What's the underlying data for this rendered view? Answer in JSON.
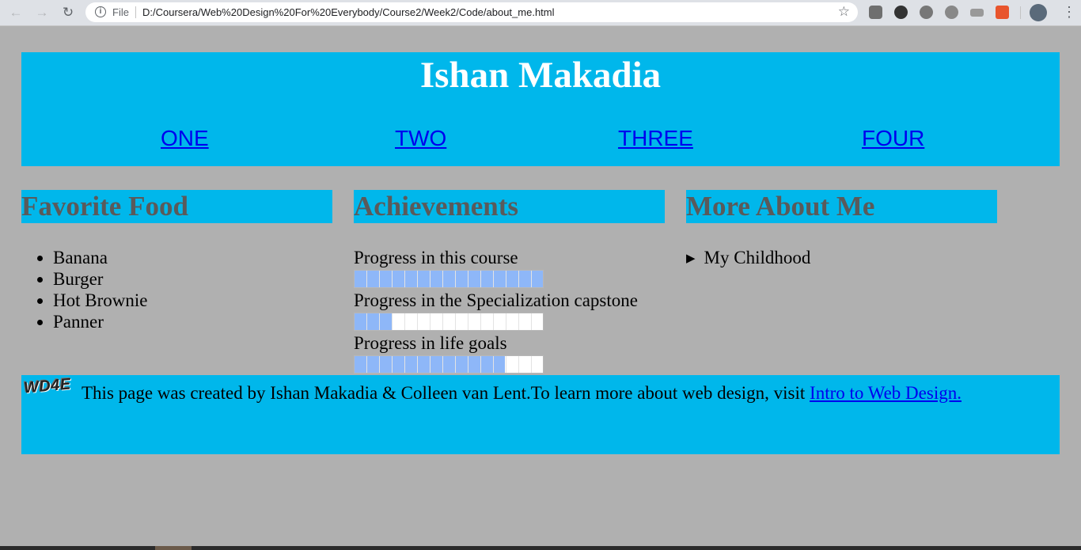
{
  "browser": {
    "back_icon": "←",
    "forward_icon": "→",
    "reload_icon": "↻",
    "scheme": "File",
    "url": "D:/Coursera/Web%20Design%20For%20Everybody/Course2/Week2/Code/about_me.html",
    "star_icon": "☆",
    "menu_icon": "⋮"
  },
  "header": {
    "title": "Ishan Makadia",
    "nav": [
      "ONE",
      "TWO",
      "THREE",
      "FOUR"
    ]
  },
  "columns": {
    "food": {
      "heading": "Favorite Food",
      "items": [
        "Banana",
        "Burger",
        "Hot Brownie",
        "Panner"
      ]
    },
    "achievements": {
      "heading": "Achievements",
      "items": [
        {
          "label": "Progress in this course",
          "value": 1.0
        },
        {
          "label": "Progress in the Specialization capstone",
          "value": 0.2
        },
        {
          "label": "Progress in life goals",
          "value": 0.8
        }
      ]
    },
    "about": {
      "heading": "More About Me",
      "summary": "My Childhood",
      "summary_icon": "▶"
    }
  },
  "footer": {
    "logo": "WD4E",
    "text": "This page was created by Ishan Makadia & Colleen van Lent.To learn more about web design, visit ",
    "link": "Intro to Web Design."
  },
  "colors": {
    "page_bg": "#b0b0b0",
    "accent": "#00b7eb",
    "heading_text": "#5a5a5a",
    "link": "#0000ee",
    "progress_fill": "#8eb7f8"
  }
}
